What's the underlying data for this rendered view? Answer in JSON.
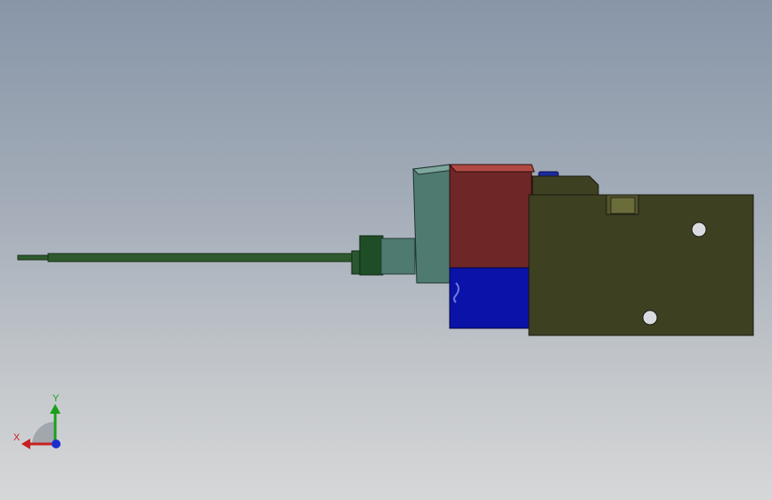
{
  "viewport": {
    "background_top": "#8896a8",
    "background_bottom": "#d6d7d8"
  },
  "model": {
    "parts": [
      "probe-rod-icon",
      "connector-nut-icon",
      "sensor-housing-icon",
      "red-block-icon",
      "blue-block-icon",
      "mounting-bracket-icon"
    ],
    "colors": {
      "rod": "#2e5a2e",
      "connector": "#1f4d26",
      "housing": "#4f7a70",
      "red_block": "#6e2626",
      "blue_block": "#0a12a8",
      "bracket": "#3e4022"
    }
  },
  "triad": {
    "y_label": "Y",
    "x_label": "X",
    "y_color": "#19a019",
    "x_color": "#c82020",
    "z_color": "#1a2ed0"
  }
}
